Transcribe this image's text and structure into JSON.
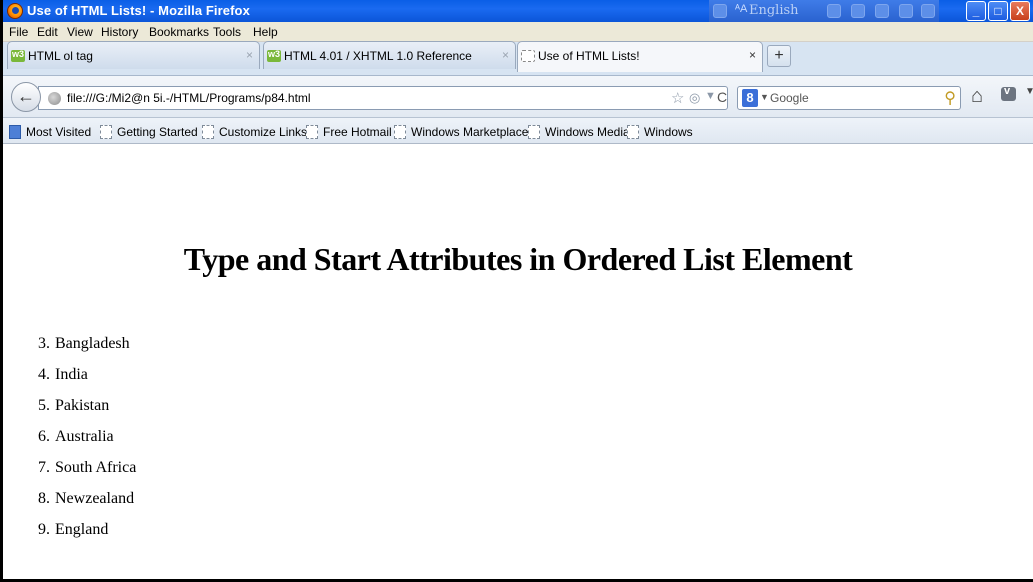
{
  "window": {
    "title": "Use of HTML Lists! - Mozilla Firefox",
    "language_indicator": "English",
    "buttons": {
      "minimize": "_",
      "maximize": "□",
      "close": "X"
    }
  },
  "menu": [
    "File",
    "Edit",
    "View",
    "History",
    "Bookmarks",
    "Tools",
    "Help"
  ],
  "tabs": [
    {
      "label": "HTML ol tag",
      "close": "×",
      "active": false,
      "icon": "w3schools-favicon"
    },
    {
      "label": "HTML 4.01 / XHTML 1.0 Reference",
      "close": "×",
      "active": false,
      "icon": "w3schools-favicon"
    },
    {
      "label": "Use of HTML Lists!",
      "close": "×",
      "active": true,
      "icon": "blank-page-favicon"
    }
  ],
  "new_tab_label": "+",
  "navigation": {
    "back_glyph": "←",
    "url": "file:///G:/Mi2@n 5i.-/HTML/Programs/p84.html",
    "search_engine": "8",
    "search_placeholder": "Google"
  },
  "bookmarks": [
    "Most Visited",
    "Getting Started",
    "Customize Links",
    "Free Hotmail",
    "Windows Marketplace",
    "Windows Media",
    "Windows"
  ],
  "page": {
    "heading": "Type and Start Attributes in Ordered List Element",
    "list": [
      {
        "num": "3.",
        "text": "Bangladesh"
      },
      {
        "num": "4.",
        "text": "India"
      },
      {
        "num": "5.",
        "text": "Pakistan"
      },
      {
        "num": "6.",
        "text": "Australia"
      },
      {
        "num": "7.",
        "text": "South Africa"
      },
      {
        "num": "8.",
        "text": "Newzealand"
      },
      {
        "num": "9.",
        "text": "England"
      }
    ]
  },
  "colors": {
    "titlebar": "#0b55d8",
    "menubar": "#ece9d8",
    "tabbar": "#d7e4f2"
  }
}
